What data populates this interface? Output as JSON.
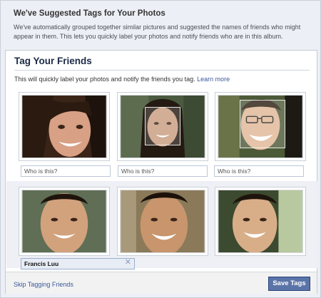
{
  "banner": {
    "title": "We've Suggested Tags for Your Photos",
    "line1": "We've automatically grouped together similar pictures and suggested the names of friends who might",
    "line2": "appear in them. This lets you quickly label your photos and notify friends who are in this album."
  },
  "dialog": {
    "title": "Tag Your Friends",
    "intro": "This will quickly label your photos and notify the friends you tag.",
    "learn_more": "Learn more"
  },
  "groups": [
    {
      "input_placeholder": "Who is this?",
      "inputs": [
        "",
        "",
        ""
      ]
    },
    {
      "input_value": "Francis Luu",
      "clear_glyph": "✕"
    }
  ],
  "footer": {
    "skip_label": "Skip Tagging Friends",
    "save_label": "Save Tags"
  },
  "colors": {
    "link": "#3b5998",
    "button": "#5b74a8",
    "title": "#1c2a47"
  }
}
